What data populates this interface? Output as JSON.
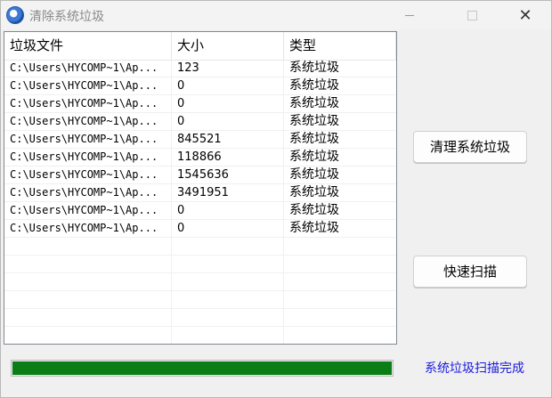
{
  "window": {
    "title": "清除系统垃圾",
    "controls": {
      "minimize": "",
      "maximize": "",
      "close": "✕"
    }
  },
  "list": {
    "columns": [
      "垃圾文件",
      "大小",
      "类型"
    ],
    "rows": [
      {
        "path": "C:\\Users\\HYCOMP~1\\Ap...",
        "size": "123",
        "type": "系统垃圾"
      },
      {
        "path": "C:\\Users\\HYCOMP~1\\Ap...",
        "size": "0",
        "type": "系统垃圾"
      },
      {
        "path": "C:\\Users\\HYCOMP~1\\Ap...",
        "size": "0",
        "type": "系统垃圾"
      },
      {
        "path": "C:\\Users\\HYCOMP~1\\Ap...",
        "size": "0",
        "type": "系统垃圾"
      },
      {
        "path": "C:\\Users\\HYCOMP~1\\Ap...",
        "size": "845521",
        "type": "系统垃圾"
      },
      {
        "path": "C:\\Users\\HYCOMP~1\\Ap...",
        "size": "118866",
        "type": "系统垃圾"
      },
      {
        "path": "C:\\Users\\HYCOMP~1\\Ap...",
        "size": "1545636",
        "type": "系统垃圾"
      },
      {
        "path": "C:\\Users\\HYCOMP~1\\Ap...",
        "size": "3491951",
        "type": "系统垃圾"
      },
      {
        "path": "C:\\Users\\HYCOMP~1\\Ap...",
        "size": "0",
        "type": "系统垃圾"
      },
      {
        "path": "C:\\Users\\HYCOMP~1\\Ap...",
        "size": "0",
        "type": "系统垃圾"
      }
    ]
  },
  "buttons": {
    "clean": "清理系统垃圾",
    "scan": "快速扫描"
  },
  "progress": {
    "value": 1.0,
    "color": "#0a7d15"
  },
  "status": {
    "text": "系统垃圾扫描完成",
    "color": "#1a1adf"
  }
}
